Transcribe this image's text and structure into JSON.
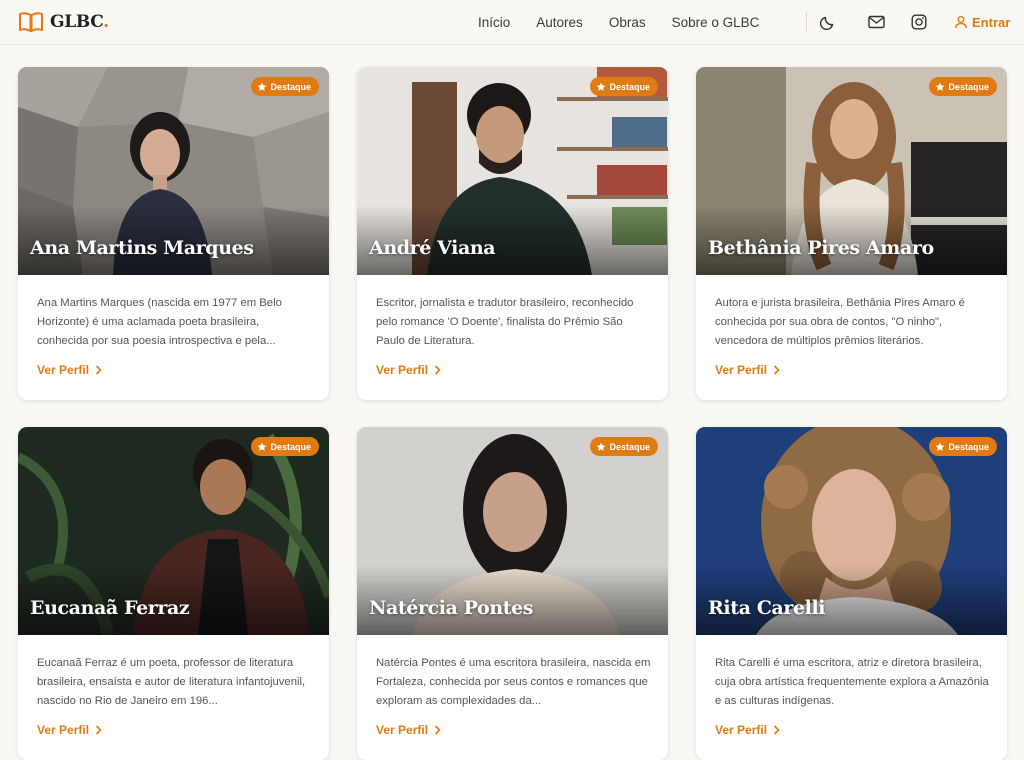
{
  "header": {
    "logo_text": "GLBC",
    "logo_dot": ".",
    "nav": [
      "Início",
      "Autores",
      "Obras",
      "Sobre o GLBC"
    ],
    "icons": [
      "moon-icon",
      "mail-icon",
      "instagram-icon"
    ],
    "login_label": "Entrar"
  },
  "colors": {
    "accent": "#e07a13",
    "background": "#faf8f4"
  },
  "cards": [
    {
      "name": "Ana Martins Marques",
      "badge": "Destaque",
      "description": "Ana Martins Marques (nascida em 1977 em Belo Horizonte) é uma aclamada poeta brasileira, conhecida por sua poesia introspectiva e pela...",
      "link": "Ver Perfil"
    },
    {
      "name": "André Viana",
      "badge": "Destaque",
      "description": "Escritor, jornalista e tradutor brasileiro, reconhecido pelo romance 'O Doente', finalista do Prêmio São Paulo de Literatura.",
      "link": "Ver Perfil"
    },
    {
      "name": "Bethânia Pires Amaro",
      "badge": "Destaque",
      "description": "Autora e jurista brasileira, Bethânia Pires Amaro é conhecida por sua obra de contos, \"O ninho\", vencedora de múltiplos prêmios literários.",
      "link": "Ver Perfil"
    },
    {
      "name": "Eucanaã Ferraz",
      "badge": "Destaque",
      "description": "Eucanaã Ferraz é um poeta, professor de literatura brasileira, ensaísta e autor de literatura infantojuvenil, nascido no Rio de Janeiro em 196...",
      "link": "Ver Perfil"
    },
    {
      "name": "Natércia Pontes",
      "badge": "Destaque",
      "description": "Natércia Pontes é uma escritora brasileira, nascida em Fortaleza, conhecida por seus contos e romances que exploram as complexidades da...",
      "link": "Ver Perfil"
    },
    {
      "name": "Rita Carelli",
      "badge": "Destaque",
      "description": "Rita Carelli é uma escritora, atriz e diretora brasileira, cuja obra artística frequentemente explora a Amazônia e as culturas indígenas.",
      "link": "Ver Perfil"
    }
  ]
}
